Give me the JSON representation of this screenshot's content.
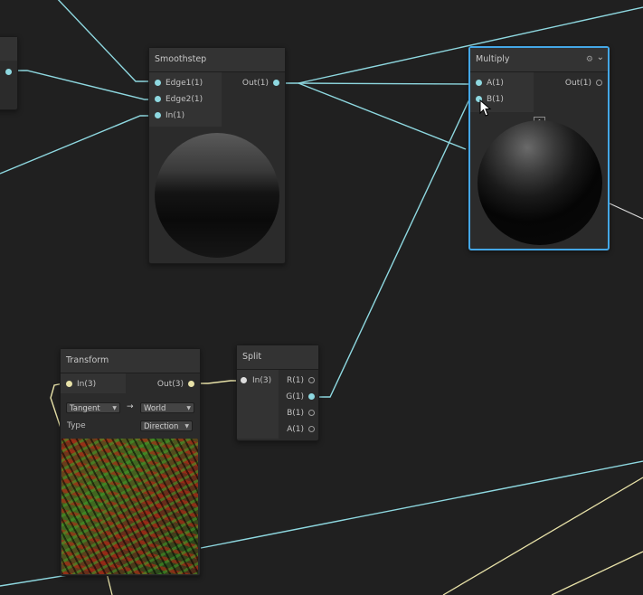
{
  "nodes": {
    "smoothstep": {
      "title": "Smoothstep",
      "inputs": [
        "Edge1(1)",
        "Edge2(1)",
        "In(1)"
      ],
      "output": "Out(1)"
    },
    "multiply": {
      "title": "Multiply",
      "inputs": [
        "A(1)",
        "B(1)"
      ],
      "output": "Out(1)",
      "collapse_glyph": "^",
      "gear_glyph": "⚙",
      "menu_glyph": "⌄"
    },
    "transform": {
      "title": "Transform",
      "input": "In(3)",
      "output": "Out(3)",
      "from_space": "Tangent",
      "to_space": "World",
      "arrow_glyph": "→",
      "type_label": "Type",
      "type_value": "Direction",
      "caret_glyph": "▼"
    },
    "split": {
      "title": "Split",
      "input": "In(3)",
      "outputs": [
        "R(1)",
        "G(1)",
        "B(1)",
        "A(1)"
      ]
    }
  },
  "colors": {
    "canvas": "#202020",
    "selection": "#44a7e6",
    "wire_float": "#8ed8e0",
    "wire_vector": "#e8e2a8"
  },
  "icons": [
    "gear-icon",
    "dropdown-menu-icon",
    "collapse-icon",
    "mouse-cursor-icon",
    "arrow-right-icon"
  ]
}
